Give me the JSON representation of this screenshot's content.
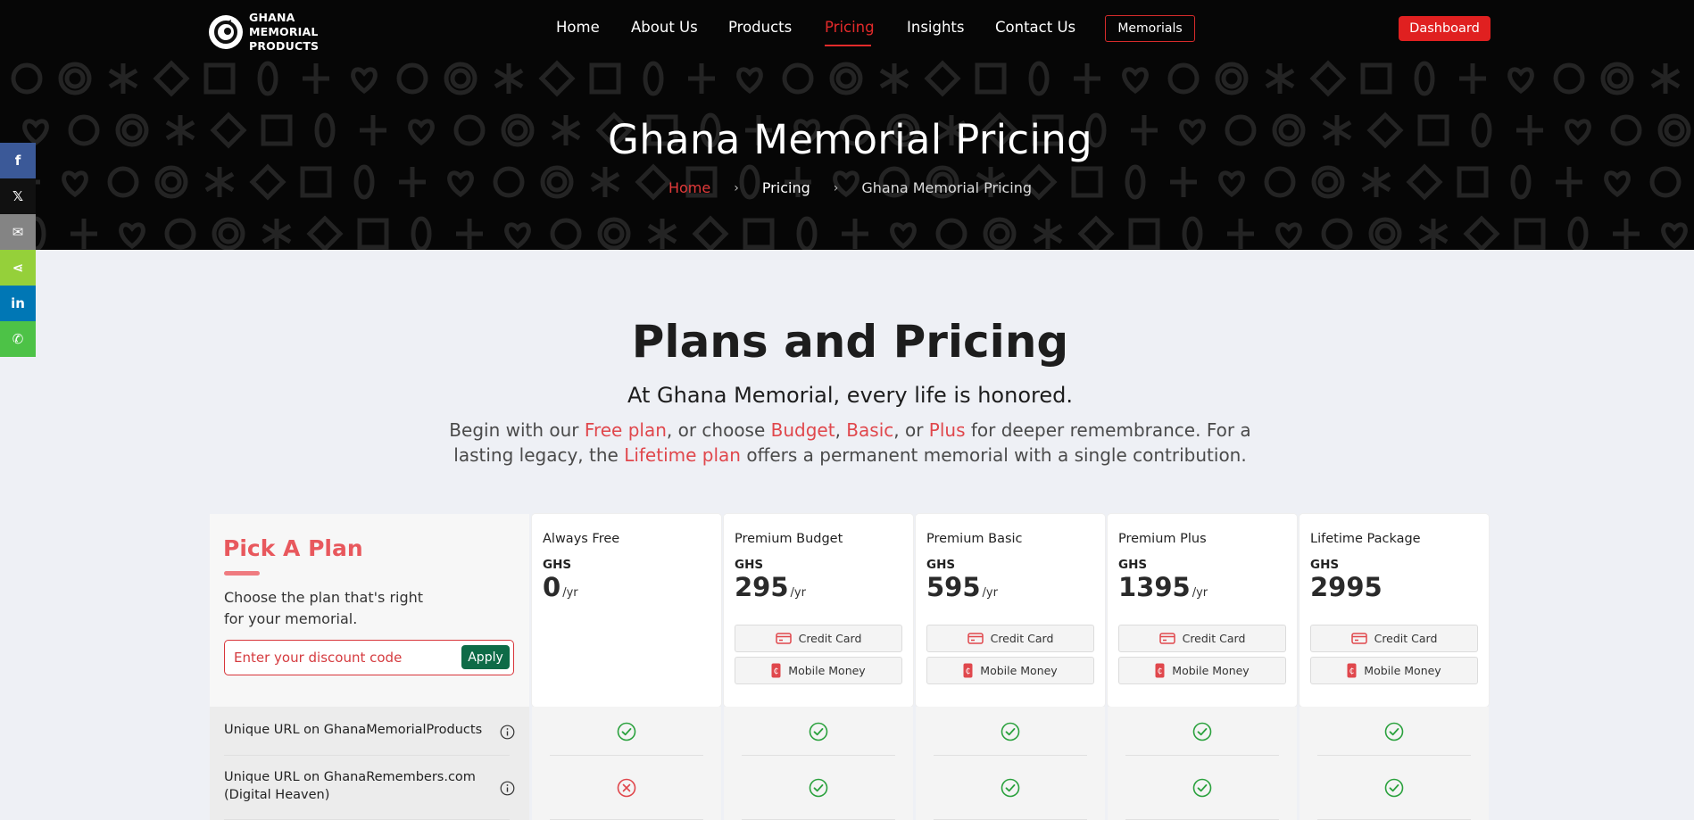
{
  "header": {
    "logo_text": "GHANA MEMORIAL PRODUCTS",
    "nav": [
      {
        "label": "Home",
        "active": false
      },
      {
        "label": "About Us",
        "active": false
      },
      {
        "label": "Products",
        "active": false
      },
      {
        "label": "Pricing",
        "active": true
      },
      {
        "label": "Insights",
        "active": false
      },
      {
        "label": "Contact Us",
        "active": false
      }
    ],
    "memorials_label": "Memorials",
    "dashboard_label": "Dashboard"
  },
  "hero": {
    "title": "Ghana Memorial Pricing",
    "breadcrumb": [
      "Home",
      "Pricing",
      "Ghana Memorial Pricing"
    ]
  },
  "share_bar": [
    {
      "network": "facebook",
      "icon": "facebook-icon",
      "color": "#3b5998",
      "glyph": "f"
    },
    {
      "network": "x",
      "icon": "x-icon",
      "color": "#111111",
      "glyph": "𝕏"
    },
    {
      "network": "email",
      "icon": "email-icon",
      "color": "#848484",
      "glyph": "✉"
    },
    {
      "network": "share",
      "icon": "share-icon",
      "color": "#95d03a",
      "glyph": "⋖"
    },
    {
      "network": "linkedin",
      "icon": "linkedin-icon",
      "color": "#0077b5",
      "glyph": "in"
    },
    {
      "network": "whatsapp",
      "icon": "whatsapp-icon",
      "color": "#4dc247",
      "glyph": "✆"
    }
  ],
  "intro": {
    "title": "Plans and Pricing",
    "tagline": "At Ghana Memorial, every life is honored.",
    "text_1": "Begin with our ",
    "free_plan": "Free plan",
    "text_2": ", or choose ",
    "budget": "Budget",
    "comma": ", ",
    "basic": "Basic",
    "text_3": ", or ",
    "plus": "Plus",
    "text_4": " for deeper remembrance. For a lasting legacy, the ",
    "lifetime_plan": "Lifetime plan",
    "text_5": " offers a permanent memorial with a single contribution."
  },
  "pick": {
    "title": "Pick A Plan",
    "description": "Choose the plan that's right for your memorial.",
    "discount_placeholder": "Enter your discount code",
    "apply_label": "Apply"
  },
  "plans": [
    {
      "name": "Always Free",
      "currency": "GHS",
      "price": "0",
      "unit": "/yr",
      "payments": []
    },
    {
      "name": "Premium Budget",
      "currency": "GHS",
      "price": "295",
      "unit": "/yr",
      "payments": [
        "Credit Card",
        "Mobile Money"
      ]
    },
    {
      "name": "Premium Basic",
      "currency": "GHS",
      "price": "595",
      "unit": "/yr",
      "payments": [
        "Credit Card",
        "Mobile Money"
      ]
    },
    {
      "name": "Premium Plus",
      "currency": "GHS",
      "price": "1395",
      "unit": "/yr",
      "payments": [
        "Credit Card",
        "Mobile Money"
      ]
    },
    {
      "name": "Lifetime Package",
      "currency": "GHS",
      "price": "2995",
      "unit": "",
      "payments": [
        "Credit Card",
        "Mobile Money"
      ]
    }
  ],
  "features": [
    {
      "label": "Unique URL on GhanaMemorialProducts",
      "availability": [
        true,
        true,
        true,
        true,
        true
      ]
    },
    {
      "label": "Unique URL on GhanaRemembers.com (Digital Heaven)",
      "availability": [
        false,
        true,
        true,
        true,
        true
      ]
    }
  ],
  "colors": {
    "accent_red": "#e02020",
    "apply_green": "#0e6b47",
    "check_green": "#2aa13d",
    "cross_red": "#e0474c"
  }
}
